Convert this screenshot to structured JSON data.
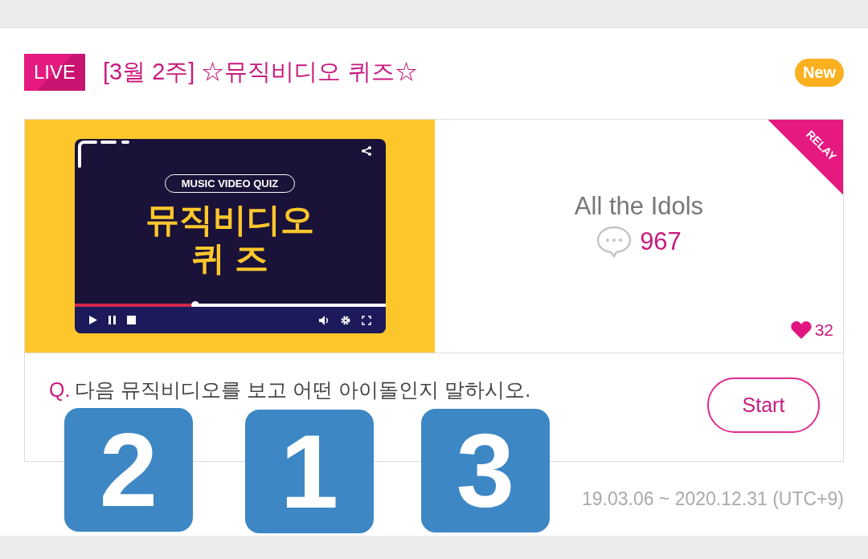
{
  "header": {
    "live_label": "LIVE",
    "title": "[3월 2주] ☆뮤직비디오 퀴즈☆",
    "new_label": "New"
  },
  "quiz": {
    "thumbnail": {
      "pill": "MUSIC VIDEO QUIZ",
      "headline": [
        "뮤직비디오",
        "퀴 즈"
      ],
      "level": 0.39
    },
    "ribbon": "RELAY",
    "category": "All the Idols",
    "comments": "967",
    "likes": "32",
    "question_mark": "Q.",
    "question": "다음 뮤직비디오를 보고 어떤 아이돌인지 말하시오.",
    "start_button": "Start"
  },
  "period": "19.03.06 ~ 2020.12.31 (UTC+9)",
  "stickers": [
    "2",
    "1",
    "3"
  ]
}
